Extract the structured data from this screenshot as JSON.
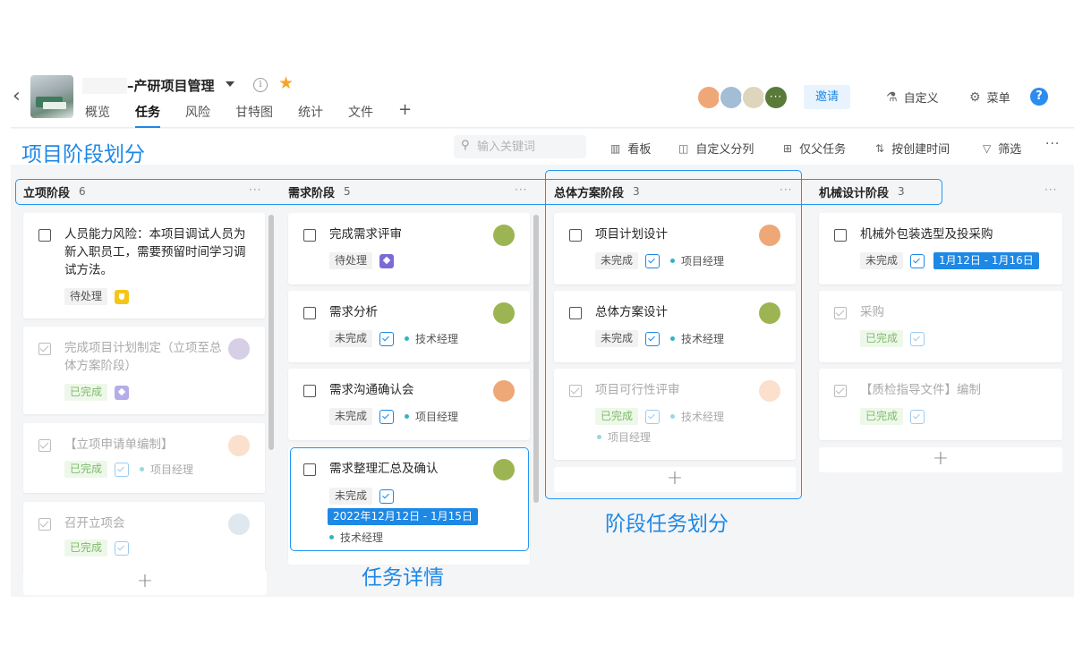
{
  "header": {
    "title": "–产研项目管理",
    "tabs": [
      "概览",
      "任务",
      "风险",
      "甘特图",
      "统计",
      "文件"
    ],
    "active_tab": "任务",
    "invite_label": "邀请",
    "customize_label": "自定义",
    "menu_label": "菜单",
    "help_label": "?"
  },
  "toolbar": {
    "search_placeholder": "输入关键词",
    "board_label": "看板",
    "custom_group_label": "自定义分列",
    "parent_only_label": "仅父任务",
    "sort_label": "按创建时间",
    "filter_label": "筛选"
  },
  "columns": [
    {
      "name": "立项阶段",
      "count": "6"
    },
    {
      "name": "需求阶段",
      "count": "5"
    },
    {
      "name": "总体方案阶段",
      "count": "3"
    },
    {
      "name": "机械设计阶段",
      "count": "3"
    }
  ],
  "cards": {
    "c1": {
      "title": "人员能力风险：本项目调试人员为新入职员工，需要预留时间学习调试方法。",
      "status": "待处理"
    },
    "c2": {
      "title": "完成项目计划制定（立项至总体方案阶段）",
      "status": "已完成"
    },
    "c3": {
      "title": "【立项申请单编制】",
      "status": "已完成",
      "role": "项目经理"
    },
    "c4": {
      "title": "召开立项会",
      "status": "已完成"
    },
    "c5": {
      "title": "完成需求评审",
      "status": "待处理"
    },
    "c6": {
      "title": "需求分析",
      "status": "未完成",
      "role": "技术经理"
    },
    "c7": {
      "title": "需求沟通确认会",
      "status": "未完成",
      "role": "项目经理"
    },
    "c8": {
      "title": "需求整理汇总及确认",
      "status": "未完成",
      "date": "2022年12月12日 - 1月15日",
      "role": "技术经理"
    },
    "c9": {
      "title": "项目计划设计",
      "status": "未完成",
      "role": "项目经理"
    },
    "c10": {
      "title": "总体方案设计",
      "status": "未完成",
      "role": "技术经理"
    },
    "c11": {
      "title": "项目可行性评审",
      "status": "已完成",
      "role": "技术经理",
      "role2": "项目经理"
    },
    "c12": {
      "title": "机械外包装选型及投采购",
      "status": "未完成",
      "date": "1月12日 - 1月16日"
    },
    "c13": {
      "title": "采购",
      "status": "已完成"
    },
    "c14": {
      "title": "【质检指导文件】编制",
      "status": "已完成"
    }
  },
  "annotations": {
    "phase_label": "项目阶段划分",
    "stage_task_label": "阶段任务划分",
    "task_detail_label": "任务详情"
  },
  "colors": {
    "accent": "#1e88e5",
    "avatar_green": "#9cb552",
    "avatar_orange": "#eea877",
    "avatar_purple": "#b5a8d0",
    "avatar_peach": "#f6c6a4",
    "avatar_blue": "#c4d4e2"
  }
}
